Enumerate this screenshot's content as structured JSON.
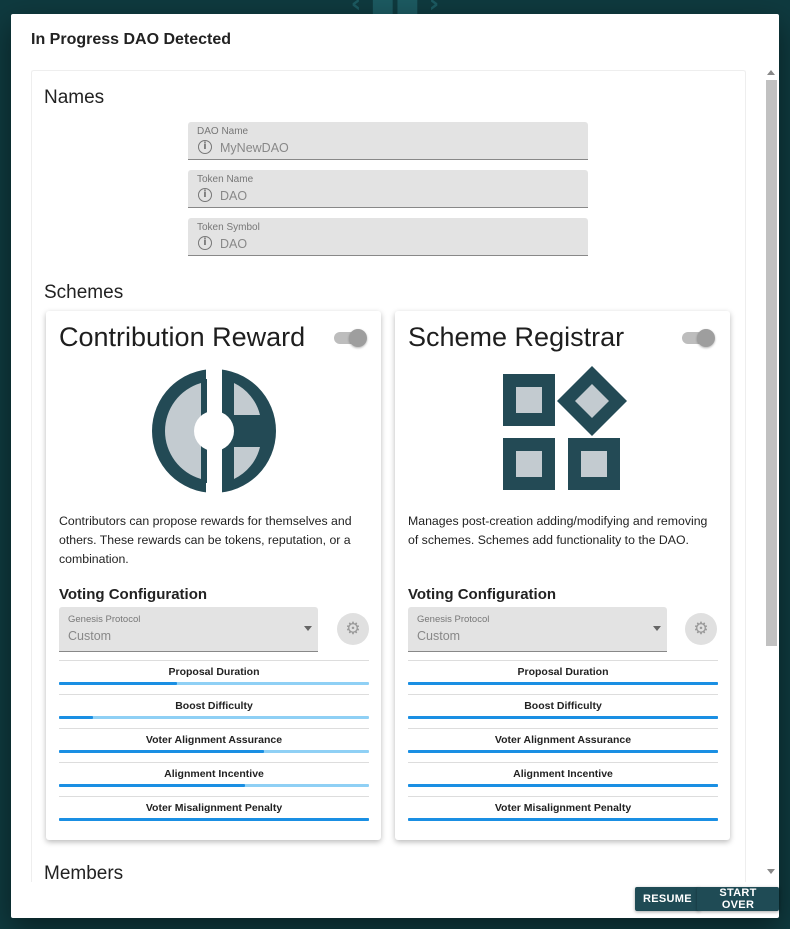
{
  "dialog": {
    "title": "In Progress DAO Detected",
    "buttons": {
      "resume": "RESUME",
      "start_over": "START OVER"
    }
  },
  "names": {
    "title": "Names",
    "fields": [
      {
        "label": "DAO Name",
        "value": "MyNewDAO",
        "icon": "info-icon"
      },
      {
        "label": "Token Name",
        "value": "DAO",
        "icon": "info-icon"
      },
      {
        "label": "Token Symbol",
        "value": "DAO",
        "icon": "info-icon"
      }
    ]
  },
  "schemes": {
    "title": "Schemes",
    "cards": [
      {
        "title": "Contribution Reward",
        "description": "Contributors can propose rewards for themselves and others. These rewards can be tokens, reputation, or a combination.",
        "voting_title": "Voting Configuration",
        "protocol_label": "Genesis Protocol",
        "protocol_value": "Custom",
        "enabled": true,
        "params": [
          {
            "label": "Proposal Duration",
            "level": 0.38
          },
          {
            "label": "Boost Difficulty",
            "level": 0.11
          },
          {
            "label": "Voter Alignment Assurance",
            "level": 0.66
          },
          {
            "label": "Alignment Incentive",
            "level": 0.6
          },
          {
            "label": "Voter Misalignment Penalty",
            "level": 1.0
          }
        ]
      },
      {
        "title": "Scheme Registrar",
        "description": "Manages post-creation adding/modifying and removing of schemes. Schemes add functionality to the DAO.",
        "voting_title": "Voting Configuration",
        "protocol_label": "Genesis Protocol",
        "protocol_value": "Custom",
        "enabled": true,
        "params": [
          {
            "label": "Proposal Duration",
            "level": 1.0
          },
          {
            "label": "Boost Difficulty",
            "level": 1.0
          },
          {
            "label": "Voter Alignment Assurance",
            "level": 1.0
          },
          {
            "label": "Alignment Incentive",
            "level": 1.0
          },
          {
            "label": "Voter Misalignment Penalty",
            "level": 1.0
          }
        ]
      }
    ]
  },
  "members": {
    "title": "Members"
  },
  "colors": {
    "icon_dark": "#234a55",
    "icon_light": "#c3cbd0",
    "slider_fill": "#1a8fe3",
    "slider_track": "#8fd0f5",
    "button_bg": "#1f4b55"
  }
}
